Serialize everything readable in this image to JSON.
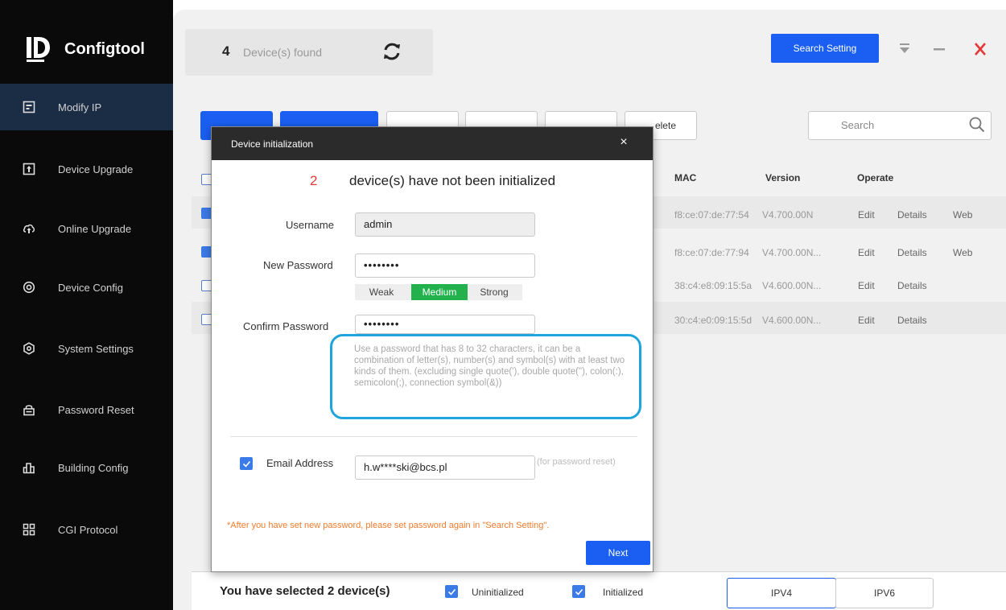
{
  "app": {
    "name": "Configtool"
  },
  "sidebar": {
    "items": [
      {
        "label": "Modify IP",
        "icon": "modify-ip-icon",
        "active": true
      },
      {
        "label": "Device Upgrade",
        "icon": "upgrade-icon",
        "active": false
      },
      {
        "label": "Online Upgrade",
        "icon": "cloud-upgrade-icon",
        "active": false
      },
      {
        "label": "Device Config",
        "icon": "device-config-icon",
        "active": false
      },
      {
        "label": "System Settings",
        "icon": "system-settings-icon",
        "active": false
      },
      {
        "label": "Password Reset",
        "icon": "password-reset-icon",
        "active": false
      },
      {
        "label": "Building Config",
        "icon": "building-config-icon",
        "active": false
      },
      {
        "label": "CGI Protocol",
        "icon": "cgi-protocol-icon",
        "active": false
      }
    ]
  },
  "header": {
    "found_count": "4",
    "found_label": "Device(s) found",
    "search_setting": "Search Setting"
  },
  "toolbar": {
    "delete_fragment": "elete",
    "search_placeholder": "Search"
  },
  "table": {
    "headers": {
      "mac": "MAC",
      "version": "Version",
      "operate": "Operate"
    },
    "rows": [
      {
        "mac": "f8:ce:07:de:77:54",
        "version": "V4.700.00N",
        "edit": "Edit",
        "details": "Details",
        "web": "Web",
        "checked": true
      },
      {
        "mac": "f8:ce:07:de:77:94",
        "version": "V4.700.00N...",
        "edit": "Edit",
        "details": "Details",
        "web": "Web",
        "checked": true
      },
      {
        "mac": "38:c4:e8:09:15:5a",
        "version": "V4.600.00N...",
        "edit": "Edit",
        "details": "Details",
        "web": "",
        "checked": false
      },
      {
        "mac": "30:c4:e0:09:15:5d",
        "version": "V4.600.00N...",
        "edit": "Edit",
        "details": "Details",
        "web": "",
        "checked": false
      }
    ]
  },
  "bottom": {
    "selected_text": "You have selected 2  device(s)",
    "uninitialized": "Uninitialized",
    "initialized": "Initialized",
    "ipv4": "IPV4",
    "ipv6": "IPV6"
  },
  "modal": {
    "title": "Device initialization",
    "close": "×",
    "count": "2",
    "heading": "device(s) have not been initialized",
    "username_label": "Username",
    "username_value": "admin",
    "new_password_label": "New Password",
    "new_password_value": "••••••••",
    "strength": {
      "weak": "Weak",
      "medium": "Medium",
      "strong": "Strong",
      "level": "Medium"
    },
    "confirm_password_label": "Confirm Password",
    "confirm_password_value": "••••••••",
    "hint": "Use a password that has 8 to 32 characters, it can be a combination of letter(s), number(s) and symbol(s) with at least two kinds of them. (excluding single quote('), double quote(\"), colon(:), semicolon(;), connection symbol(&))",
    "email_label": "Email Address",
    "email_value": "h.w****ski@bcs.pl",
    "email_hint": "(for password reset)",
    "warning": "*After you have set new password, please set password again in \"Search Setting\".",
    "next": "Next"
  },
  "colors": {
    "accent": "#1a5ff2",
    "strength_medium": "#22b14c",
    "highlight": "#1fa5de",
    "warning": "#f07a2c",
    "count_red": "#e53935"
  }
}
